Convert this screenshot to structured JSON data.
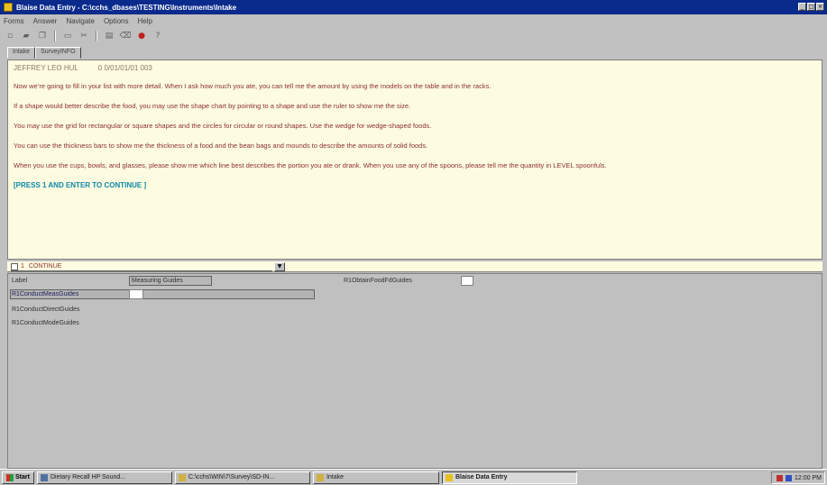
{
  "window": {
    "title": "Blaise Data Entry - C:\\cchs_dbases\\TESTING\\Instruments\\Intake",
    "controls": [
      "_",
      "□",
      "×"
    ]
  },
  "menu": [
    "Forms",
    "Answer",
    "Navigate",
    "Options",
    "Help"
  ],
  "toolbar": {
    "icons": [
      "new-icon",
      "open-icon",
      "copy-icon",
      "paste-icon",
      "cut-icon",
      "print-icon",
      "delete-icon",
      "stop-icon",
      "help-icon"
    ]
  },
  "tabs": [
    "Intake",
    "SurveyINFO"
  ],
  "question": {
    "header": "JEFFREY LEO HUL          0 0/01/01/01 003",
    "paragraphs": [
      "Now we’re going to fill in your list with more detail.  When I ask how much you ate, you can tell me the amount by using the models on the table and in the racks.",
      "If a shape would better describe the food, you may use the shape chart by pointing to a shape and use the ruler to show me the size.",
      "You may use the grid for rectangular or square shapes and the circles for circular or round shapes.  Use the wedge for wedge-shaped foods.",
      "You can use the thickness bars to show me the thickness of a food and the bean bags and mounds to describe the amounts of solid foods.",
      "When you use the cups, bowls, and glasses, please show me which line best describes the portion you ate or drank.  When you use any of the spoons, please tell me the quantity in LEVEL spoonfuls."
    ],
    "press_prompt": "[PRESS 1 AND ENTER TO CONTINUE ]"
  },
  "answer": {
    "code": "1",
    "label": "CONTINUE",
    "dropdown_glyph": "▼"
  },
  "form": {
    "label_header": "Label",
    "column_header": "Measuring Guides",
    "rows": [
      "R1ConductMeasGuides",
      "R1ConductDirectGuides",
      "R1ConductModeGuides"
    ],
    "right_label": "R1ObtainFoodFdGuides"
  },
  "taskbar": {
    "start": "Start",
    "tasks": [
      "Dietary Recall HP Sound...",
      "C:\\cchs\\WIN\\7\\Survey\\SD-IN...",
      "Intake",
      "Blaise Data Entry"
    ],
    "clock": "12:00 PM"
  }
}
